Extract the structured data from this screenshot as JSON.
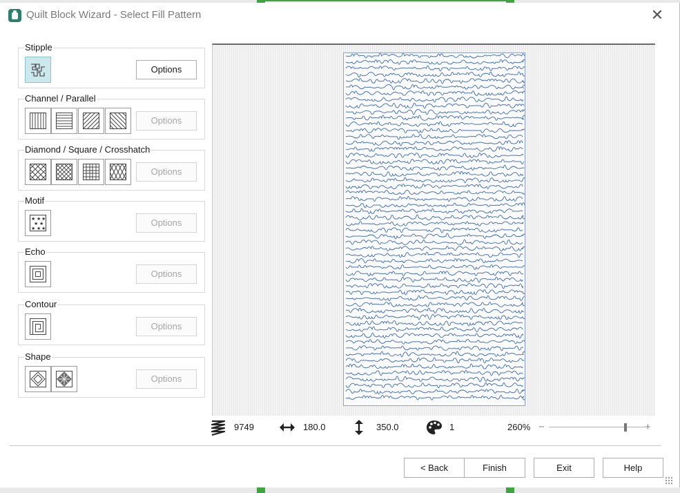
{
  "window": {
    "title": "Quilt Block Wizard - Select Fill Pattern",
    "close_icon": "close-icon"
  },
  "groups": [
    {
      "label": "Stipple",
      "options_label": "Options",
      "options_enabled": true,
      "thumbs": [
        "stipple-icon"
      ],
      "selected": 0
    },
    {
      "label": "Channel / Parallel",
      "options_label": "Options",
      "options_enabled": false,
      "thumbs": [
        "channel-vertical-icon",
        "channel-horizontal-icon",
        "channel-diagonal-right-icon",
        "channel-diagonal-left-icon"
      ]
    },
    {
      "label": "Diamond / Square / Crosshatch",
      "options_label": "Options",
      "options_enabled": false,
      "thumbs": [
        "diamond-crosshatch-icon",
        "diamond-small-icon",
        "square-grid-icon",
        "diamond-tall-icon"
      ]
    },
    {
      "label": "Motif",
      "options_label": "Options",
      "options_enabled": false,
      "thumbs": [
        "star-motif-icon"
      ]
    },
    {
      "label": "Echo",
      "options_label": "Options",
      "options_enabled": false,
      "thumbs": [
        "echo-icon"
      ]
    },
    {
      "label": "Contour",
      "options_label": "Options",
      "options_enabled": false,
      "thumbs": [
        "contour-icon"
      ]
    },
    {
      "label": "Shape",
      "options_label": "Options",
      "options_enabled": false,
      "thumbs": [
        "shape-diamond-icon",
        "shape-pattern-icon"
      ]
    }
  ],
  "status": {
    "stitches_icon": "stitch-count-icon",
    "stitch_count": "9749",
    "width_icon": "width-arrows-icon",
    "width": "180.0",
    "height_icon": "height-arrows-icon",
    "height": "350.0",
    "colors_icon": "palette-icon",
    "color_count": "1",
    "zoom": "260%",
    "zoom_level": 0.8
  },
  "buttons": {
    "back": "< Back",
    "finish": "Finish",
    "exit": "Exit",
    "help": "Help"
  },
  "colors": {
    "stitch_line": "#4a72b8",
    "selected_thumb": "#cbe9ec",
    "frame": "#8ea3c4"
  }
}
